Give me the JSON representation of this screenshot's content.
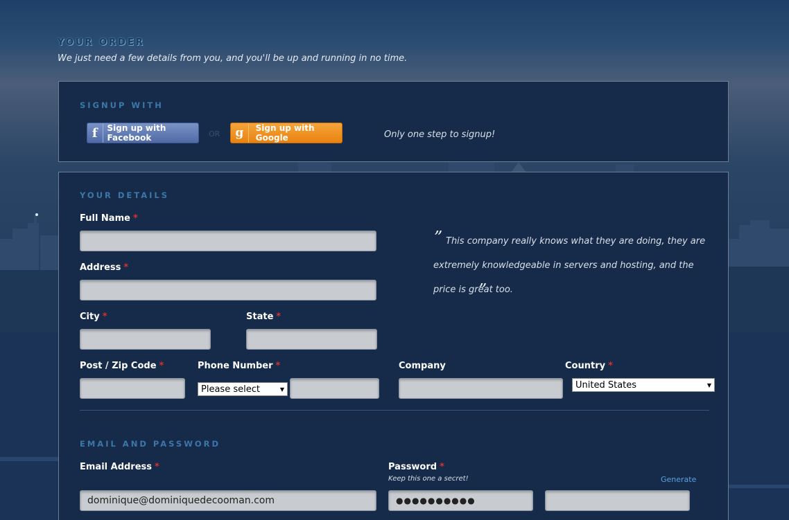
{
  "header": {
    "title": "YOUR ORDER",
    "subtitle": "We just need a few details from you, and you'll be up and running in no time."
  },
  "signup": {
    "title": "SIGNUP WITH",
    "facebook_icon": "f",
    "facebook_label": "Sign up with Facebook",
    "or_text": "OR",
    "google_icon": "g",
    "google_label": "Sign up with Google",
    "hint": "Only one step to signup!"
  },
  "details": {
    "title": "YOUR DETAILS",
    "required_marker": "*",
    "full_name_label": "Full Name",
    "address_label": "Address",
    "city_label": "City",
    "state_label": "State",
    "postcode_label": "Post / Zip Code",
    "phone_label": "Phone Number",
    "phone_select_value": "Please select",
    "company_label": "Company",
    "country_label": "Country",
    "country_value": "United States"
  },
  "testimonial": {
    "open_quote": "”",
    "text": "This company really knows what they are doing, they are extremely knowledgeable in servers and hosting, and the price is great too.",
    "close_quote": "”"
  },
  "account": {
    "title": "EMAIL AND PASSWORD",
    "email_label": "Email Address",
    "email_value": "dominique@dominiquedecooman.com",
    "password_label": "Password",
    "password_note": "Keep this one a secret!",
    "generate_label": "Generate",
    "password_value": "●●●●●●●●●●"
  },
  "colors": {
    "panel_bg": "#162a49",
    "section_title": "#3c77a9",
    "required": "#d73131",
    "facebook": "#4f6aa6",
    "google": "#e9820f",
    "link": "#5aa3de"
  }
}
